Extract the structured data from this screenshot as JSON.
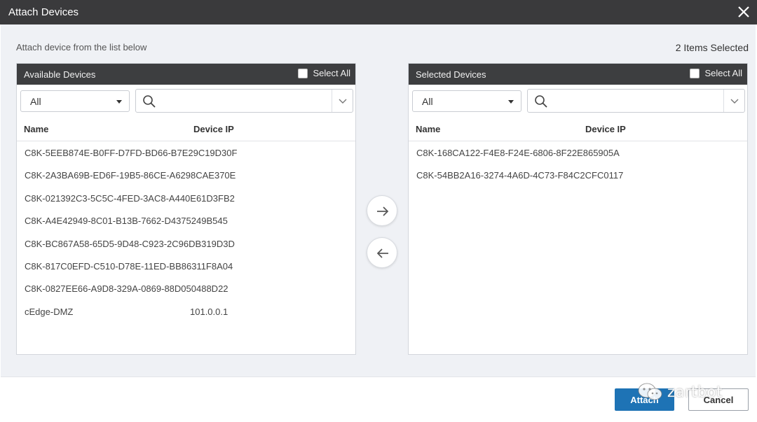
{
  "dialog": {
    "title": "Attach Devices",
    "subtitle": "Attach device from the list below",
    "selected_count": "2 Items Selected"
  },
  "left_panel": {
    "title": "Available Devices",
    "select_all_label": "Select All",
    "select_all_checked": false,
    "filter_value": "All",
    "search_placeholder": "",
    "search_icon": "search-icon",
    "col_name": "Name",
    "col_ip": "Device IP",
    "rows": [
      {
        "name": "C8K-5EEB874E-B0FF-D7FD-BD66-B7E29C19D30F",
        "ip": ""
      },
      {
        "name": "C8K-2A3BA69B-ED6F-19B5-86CE-A6298CAE370E",
        "ip": ""
      },
      {
        "name": "C8K-021392C3-5C5C-4FED-3AC8-A440E61D3FB2",
        "ip": ""
      },
      {
        "name": "C8K-A4E42949-8C01-B13B-7662-D4375249B545",
        "ip": ""
      },
      {
        "name": "C8K-BC867A58-65D5-9D48-C923-2C96DB319D3D",
        "ip": ""
      },
      {
        "name": "C8K-817C0EFD-C510-D78E-11ED-BB86311F8A04",
        "ip": ""
      },
      {
        "name": "C8K-0827EE66-A9D8-329A-0869-88D050488D22",
        "ip": ""
      },
      {
        "name": "cEdge-DMZ",
        "ip": "101.0.0.1"
      }
    ]
  },
  "right_panel": {
    "title": "Selected Devices",
    "select_all_label": "Select All",
    "select_all_checked": false,
    "filter_value": "All",
    "search_placeholder": "",
    "search_icon": "search-icon",
    "col_name": "Name",
    "col_ip": "Device IP",
    "rows": [
      {
        "name": "C8K-168CA122-F4E8-F24E-6806-8F22E865905A",
        "ip": ""
      },
      {
        "name": "C8K-54BB2A16-3274-4A6D-4C73-F84C2CFC0117",
        "ip": ""
      }
    ]
  },
  "transfer": {
    "move_right_icon": "arrow-right-icon",
    "move_left_icon": "arrow-left-icon"
  },
  "footer": {
    "attach_label": "Attach",
    "cancel_label": "Cancel",
    "primary_color": "#1e73b5"
  },
  "watermark": {
    "text": "zartbot",
    "icon": "wechat-icon"
  }
}
